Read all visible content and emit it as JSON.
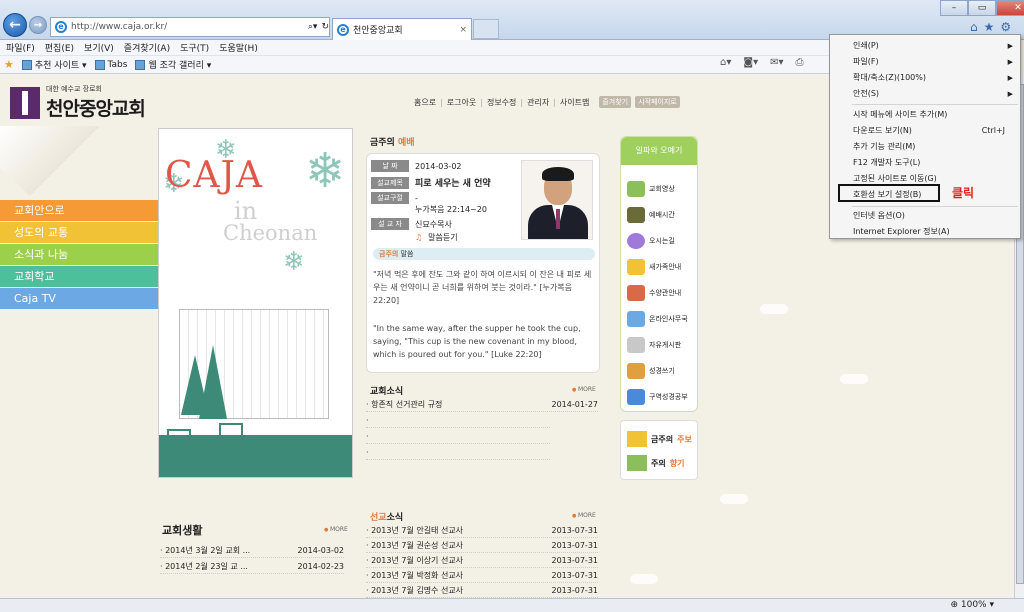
{
  "browser": {
    "address": "http://www.caja.or.kr/",
    "tab_title": "천안중앙교회",
    "menubar": [
      "파일(F)",
      "편집(E)",
      "보기(V)",
      "즐겨찾기(A)",
      "도구(T)",
      "도움말(H)"
    ],
    "favbar": [
      "추천 사이트 ▾",
      "Tabs",
      "웹 조각 갤러리 ▾"
    ],
    "zoom": "100%"
  },
  "context_menu": {
    "items": [
      {
        "label": "인쇄(P)",
        "arrow": "▶"
      },
      {
        "label": "파일(F)",
        "arrow": "▶"
      },
      {
        "label": "확대/축소(Z)(100%)",
        "arrow": "▶"
      },
      {
        "label": "안전(S)",
        "arrow": "▶"
      },
      {
        "label": "시작 메뉴에 사이트 추가(M)"
      },
      {
        "label": "다운로드 보기(N)",
        "shortcut": "Ctrl+J"
      },
      {
        "label": "추가 기능 관리(M)"
      },
      {
        "label": "F12 개발자 도구(L)"
      },
      {
        "label": "고정된 사이트로 이동(G)"
      },
      {
        "label": "호환성 보기 설정(B)"
      },
      {
        "label": "인터넷 옵션(O)"
      },
      {
        "label": "Internet Explorer 정보(A)"
      }
    ],
    "annotation": "클릭"
  },
  "site": {
    "logo_sub": "대한 예수교 장로회",
    "logo_name": "천안중앙교회",
    "topnav": [
      "홈으로",
      "로그아웃",
      "정보수정",
      "관리자",
      "사이트맵"
    ],
    "pills": [
      "즐겨찾기",
      "시작페이지로"
    ],
    "leftnav": [
      {
        "label": "교회안으로",
        "color": "#f59a34"
      },
      {
        "label": "성도의 교통",
        "color": "#f2c236"
      },
      {
        "label": "소식과 나눔",
        "color": "#9ccf4a"
      },
      {
        "label": "교회학교",
        "color": "#4cbf9b"
      },
      {
        "label": "Caja TV",
        "color": "#6ba8e4"
      }
    ],
    "visual": {
      "title": "CAJA",
      "in": "in",
      "city": "Cheonan"
    }
  },
  "sermon": {
    "head_prefix": "금주의",
    "head_accent": "예배",
    "rows": [
      {
        "label": "날 짜",
        "value": "2014-03-02"
      },
      {
        "label": "설교제목",
        "value": "피로 세우는 새 언약"
      },
      {
        "label": "설교구절",
        "value": "-"
      },
      {
        "label": "",
        "value": "누가복음 22:14~20"
      },
      {
        "label": "설 교 자",
        "value": "신묘수목사"
      }
    ],
    "listen": "말씀듣기",
    "word_prefix": "금주의",
    "word_label": "말씀",
    "korean": "\"저녁 먹은 후에 잔도 그와 같이 하여 이르시되 이 잔은 내 피로 세우는 새 언약이니 곧 너희를 위하여 붓는 것이라.\" [누가복음 22:20]",
    "english": "\"In the same way, after the supper he took the cup, saying, \"This cup is the new covenant in my blood, which is poured out for you.\" [Luke 22:20]"
  },
  "quick": {
    "title": "일파와 오예기",
    "items": [
      {
        "label": "교회영상",
        "color": "#8bbf5a"
      },
      {
        "label": "예배시간",
        "color": "#6a6a3a"
      },
      {
        "label": "오시는길",
        "color": "#a07ad8"
      },
      {
        "label": "새가족안내",
        "color": "#f2c236"
      },
      {
        "label": "수양관안내",
        "color": "#d86a4a"
      },
      {
        "label": "온라인사무국",
        "color": "#6ba8e4"
      },
      {
        "label": "자유게시판",
        "color": "#c8c8c8"
      },
      {
        "label": "성경쓰기",
        "color": "#e0a040"
      },
      {
        "label": "구역성경공부",
        "color": "#4a8ad8"
      }
    ]
  },
  "week": {
    "row1_prefix": "금주의",
    "row1_accent": "주보",
    "row2_prefix": "주의",
    "row2_accent": "향기"
  },
  "news": {
    "title": "교회소식",
    "more": "MORE",
    "items": [
      {
        "title": "· 항존직 선거관리 규정",
        "date": "2014-01-27"
      },
      {
        "title": "·",
        "date": ""
      },
      {
        "title": "·",
        "date": ""
      },
      {
        "title": "·",
        "date": ""
      }
    ]
  },
  "mission": {
    "title_accent": "선교",
    "title_rest": "소식",
    "more": "MORE",
    "items": [
      {
        "title": "· 2013년 7월 안길태 선교사",
        "date": "2013-07-31"
      },
      {
        "title": "· 2013년 7월 권순성 선교사",
        "date": "2013-07-31"
      },
      {
        "title": "· 2013년 7월 이상기 선교사",
        "date": "2013-07-31"
      },
      {
        "title": "· 2013년 7월 박정화 선교사",
        "date": "2013-07-31"
      },
      {
        "title": "· 2013년 7월 김명수 선교사",
        "date": "2013-07-31"
      }
    ]
  },
  "life": {
    "title": "교회생활",
    "more": "MORE",
    "items": [
      {
        "title": "· 2014년 3월 2일 교회 ...",
        "date": "2014-03-02"
      },
      {
        "title": "· 2014년 2월 23일 교 ...",
        "date": "2014-02-23"
      }
    ]
  }
}
